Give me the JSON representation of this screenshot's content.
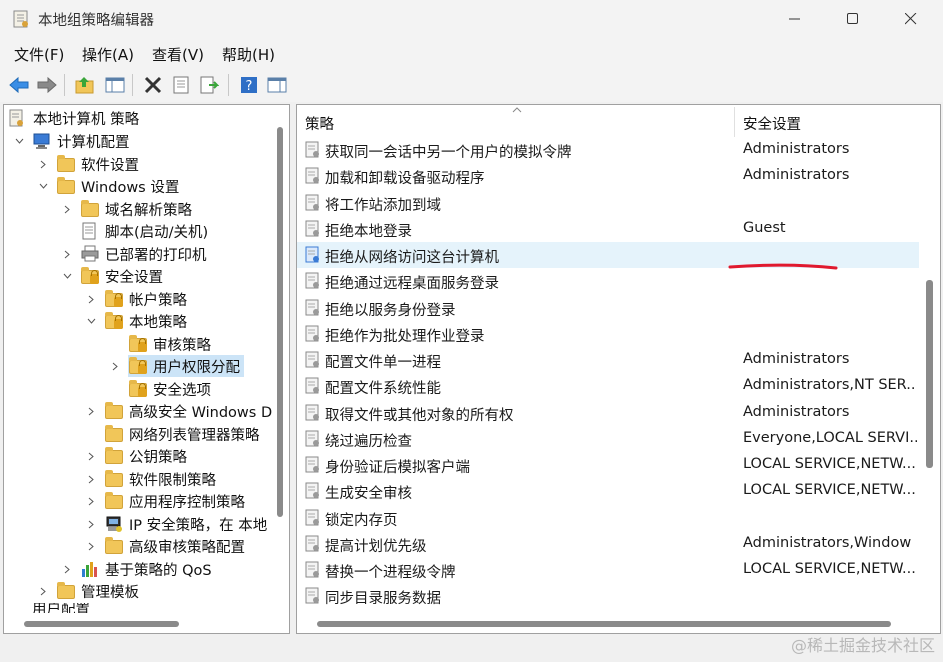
{
  "window": {
    "title": "本地组策略编辑器"
  },
  "menu": [
    "文件(F)",
    "操作(A)",
    "查看(V)",
    "帮助(H)"
  ],
  "tree": {
    "root": "本地计算机 策略",
    "computer_config": "计算机配置",
    "software_settings": "软件设置",
    "windows_settings": "Windows 设置",
    "dns_policy": "域名解析策略",
    "scripts": "脚本(启动/关机)",
    "printers": "已部署的打印机",
    "security_settings": "安全设置",
    "account_policies": "帐户策略",
    "local_policies": "本地策略",
    "audit_policy": "审核策略",
    "user_rights": "用户权限分配",
    "security_options": "安全选项",
    "adv_firewall": "高级安全 Windows D",
    "network_list": "网络列表管理器策略",
    "public_key": "公钥策略",
    "software_restriction": "软件限制策略",
    "app_control": "应用程序控制策略",
    "ipsec": "IP 安全策略，在 本地",
    "adv_audit": "高级审核策略配置",
    "qos": "基于策略的 QoS",
    "admin_templates": "管理模板",
    "user_config": "用户配置"
  },
  "table": {
    "col_policy": "策略",
    "col_setting": "安全设置",
    "rows": [
      {
        "policy": "获取同一会话中另一个用户的模拟令牌",
        "setting": "Administrators"
      },
      {
        "policy": "加载和卸载设备驱动程序",
        "setting": "Administrators"
      },
      {
        "policy": "将工作站添加到域",
        "setting": ""
      },
      {
        "policy": "拒绝本地登录",
        "setting": "Guest"
      },
      {
        "policy": "拒绝从网络访问这台计算机",
        "setting": ""
      },
      {
        "policy": "拒绝通过远程桌面服务登录",
        "setting": ""
      },
      {
        "policy": "拒绝以服务身份登录",
        "setting": ""
      },
      {
        "policy": "拒绝作为批处理作业登录",
        "setting": ""
      },
      {
        "policy": "配置文件单一进程",
        "setting": "Administrators"
      },
      {
        "policy": "配置文件系统性能",
        "setting": "Administrators,NT SER..."
      },
      {
        "policy": "取得文件或其他对象的所有权",
        "setting": "Administrators"
      },
      {
        "policy": "绕过遍历检查",
        "setting": "Everyone,LOCAL SERVI..."
      },
      {
        "policy": "身份验证后模拟客户端",
        "setting": "LOCAL SERVICE,NETW..."
      },
      {
        "policy": "生成安全审核",
        "setting": "LOCAL SERVICE,NETW..."
      },
      {
        "policy": "锁定内存页",
        "setting": ""
      },
      {
        "policy": "提高计划优先级",
        "setting": "Administrators,Window ..."
      },
      {
        "policy": "替换一个进程级令牌",
        "setting": "LOCAL SERVICE,NETW..."
      },
      {
        "policy": "同步目录服务数据",
        "setting": ""
      }
    ]
  },
  "watermark": "@稀土掘金技术社区",
  "colors": {
    "selection": "#cce4f7",
    "hover": "#e5f3fb",
    "annotation": "#e0192e"
  }
}
